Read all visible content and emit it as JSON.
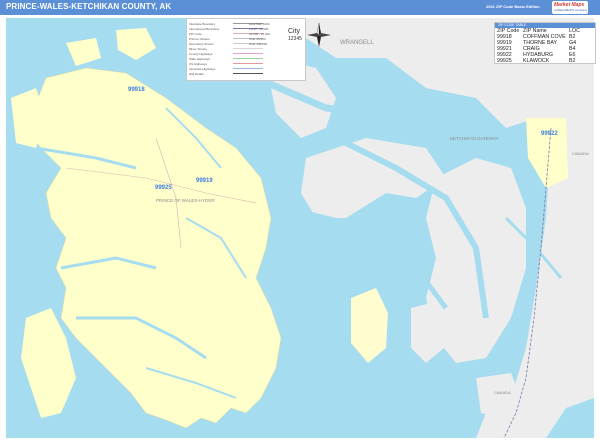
{
  "header": {
    "title": "PRINCE-WALES-KETCHIKAN COUNTY, AK",
    "subtitle": "2021 ZIP Code Basic Edition",
    "logo_brand": "Market Maps",
    "logo_sub": "a MarketMAPS company"
  },
  "colors": {
    "header": "#5b8fd6",
    "water": "#a6dcf0",
    "county_land": "#ffffcc",
    "outside_land": "#ededed",
    "zip_label": "#3f7fe0"
  },
  "compass_icon": "compass-rose-icon",
  "legend": {
    "rows": [
      {
        "label": "Interstate Boundary",
        "right": "Less than 1000"
      },
      {
        "label": "International Boundary",
        "right": "1,000 - 10,000"
      },
      {
        "label": "ZIP Code",
        "right": "10,000 - 25,000"
      },
      {
        "label": "Primary Streets",
        "right": "Over 25,000"
      },
      {
        "label": "Secondary Streets",
        "right": "Over 100,000"
      },
      {
        "label": "Minor Streets",
        "right": ""
      },
      {
        "label": "County Highways",
        "right": ""
      },
      {
        "label": "State Highways",
        "right": ""
      },
      {
        "label": "US Highways",
        "right": ""
      },
      {
        "label": "Interstate Highways",
        "right": ""
      },
      {
        "label": "Rail Roads",
        "right": ""
      }
    ],
    "city_label": "City",
    "zip_label": "12345"
  },
  "zip_table": {
    "title": "ZIP CODE TABLE",
    "headers": [
      "ZIP Code",
      "ZIP Name",
      "LOC"
    ],
    "rows": [
      [
        "99918",
        "COFFMAN COVE",
        "B2"
      ],
      [
        "99919",
        "THORNE BAY",
        "G4"
      ],
      [
        "99921",
        "CRAIG",
        "B4"
      ],
      [
        "99922",
        "HYDABURG",
        "E6"
      ],
      [
        "99925",
        "KLAWOCK",
        "B2"
      ]
    ]
  },
  "map_labels": {
    "wrangell": "WRANGELL",
    "ketchikan_gateway": "KETCHIKAN GATEWAY",
    "canada_east": "CANADA",
    "canada_south": "CANADA",
    "prince_of_wales": "PRINCE OF WALES-HYDER",
    "zips": [
      "99918",
      "99925",
      "99919",
      "99922"
    ]
  }
}
